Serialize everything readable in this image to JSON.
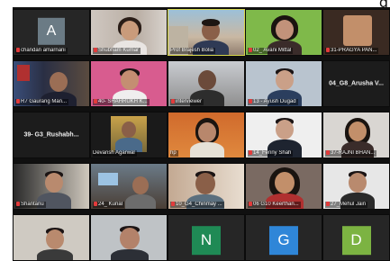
{
  "top_fragment": "g",
  "tiles": [
    {
      "name": "chandan amarnani",
      "avatar": "A",
      "avatar_color": "#6b7b85",
      "muted": true
    },
    {
      "name": "Shubham Kumar",
      "muted": true
    },
    {
      "name": "Prof Brajesh Bolia",
      "muted": false
    },
    {
      "name": "02_ Avani Mittal",
      "muted": true
    },
    {
      "name": "31-PRAGYA PAN...",
      "muted": true
    },
    {
      "name": "R7 Gaurang Man...",
      "muted": true
    },
    {
      "name": "40- SHAHRUKH K...",
      "muted": true
    },
    {
      "name": "interviewer",
      "muted": true
    },
    {
      "name": "13 - Ayush Dugad",
      "muted": true
    },
    {
      "name": "",
      "title": "04_G8_Arusha V...",
      "muted": false
    },
    {
      "name": "",
      "title": "39- G3_Rushabh...",
      "muted": false
    },
    {
      "name": "Devansh Agarwal",
      "muted": false
    },
    {
      "name": "hp",
      "muted": false
    },
    {
      "name": "14_Fenny Shah",
      "muted": true
    },
    {
      "name": "37-RAJNI BHAN...",
      "muted": true
    },
    {
      "name": "Shantanu",
      "muted": true
    },
    {
      "name": "24_ Kunal",
      "muted": true
    },
    {
      "name": "10_G4_Chinmay ...",
      "muted": true
    },
    {
      "name": "06 G10 Keerthan...",
      "muted": true
    },
    {
      "name": "27_Mehul Jain",
      "muted": true
    },
    {
      "name": "",
      "muted": false
    },
    {
      "name": "",
      "muted": false
    },
    {
      "name": "",
      "avatar": "N",
      "avatar_color": "#1f8a55",
      "muted": false
    },
    {
      "name": "",
      "avatar": "G",
      "avatar_color": "#2f86d8",
      "muted": false
    },
    {
      "name": "",
      "avatar": "D",
      "avatar_color": "#7cb342",
      "muted": false
    }
  ]
}
